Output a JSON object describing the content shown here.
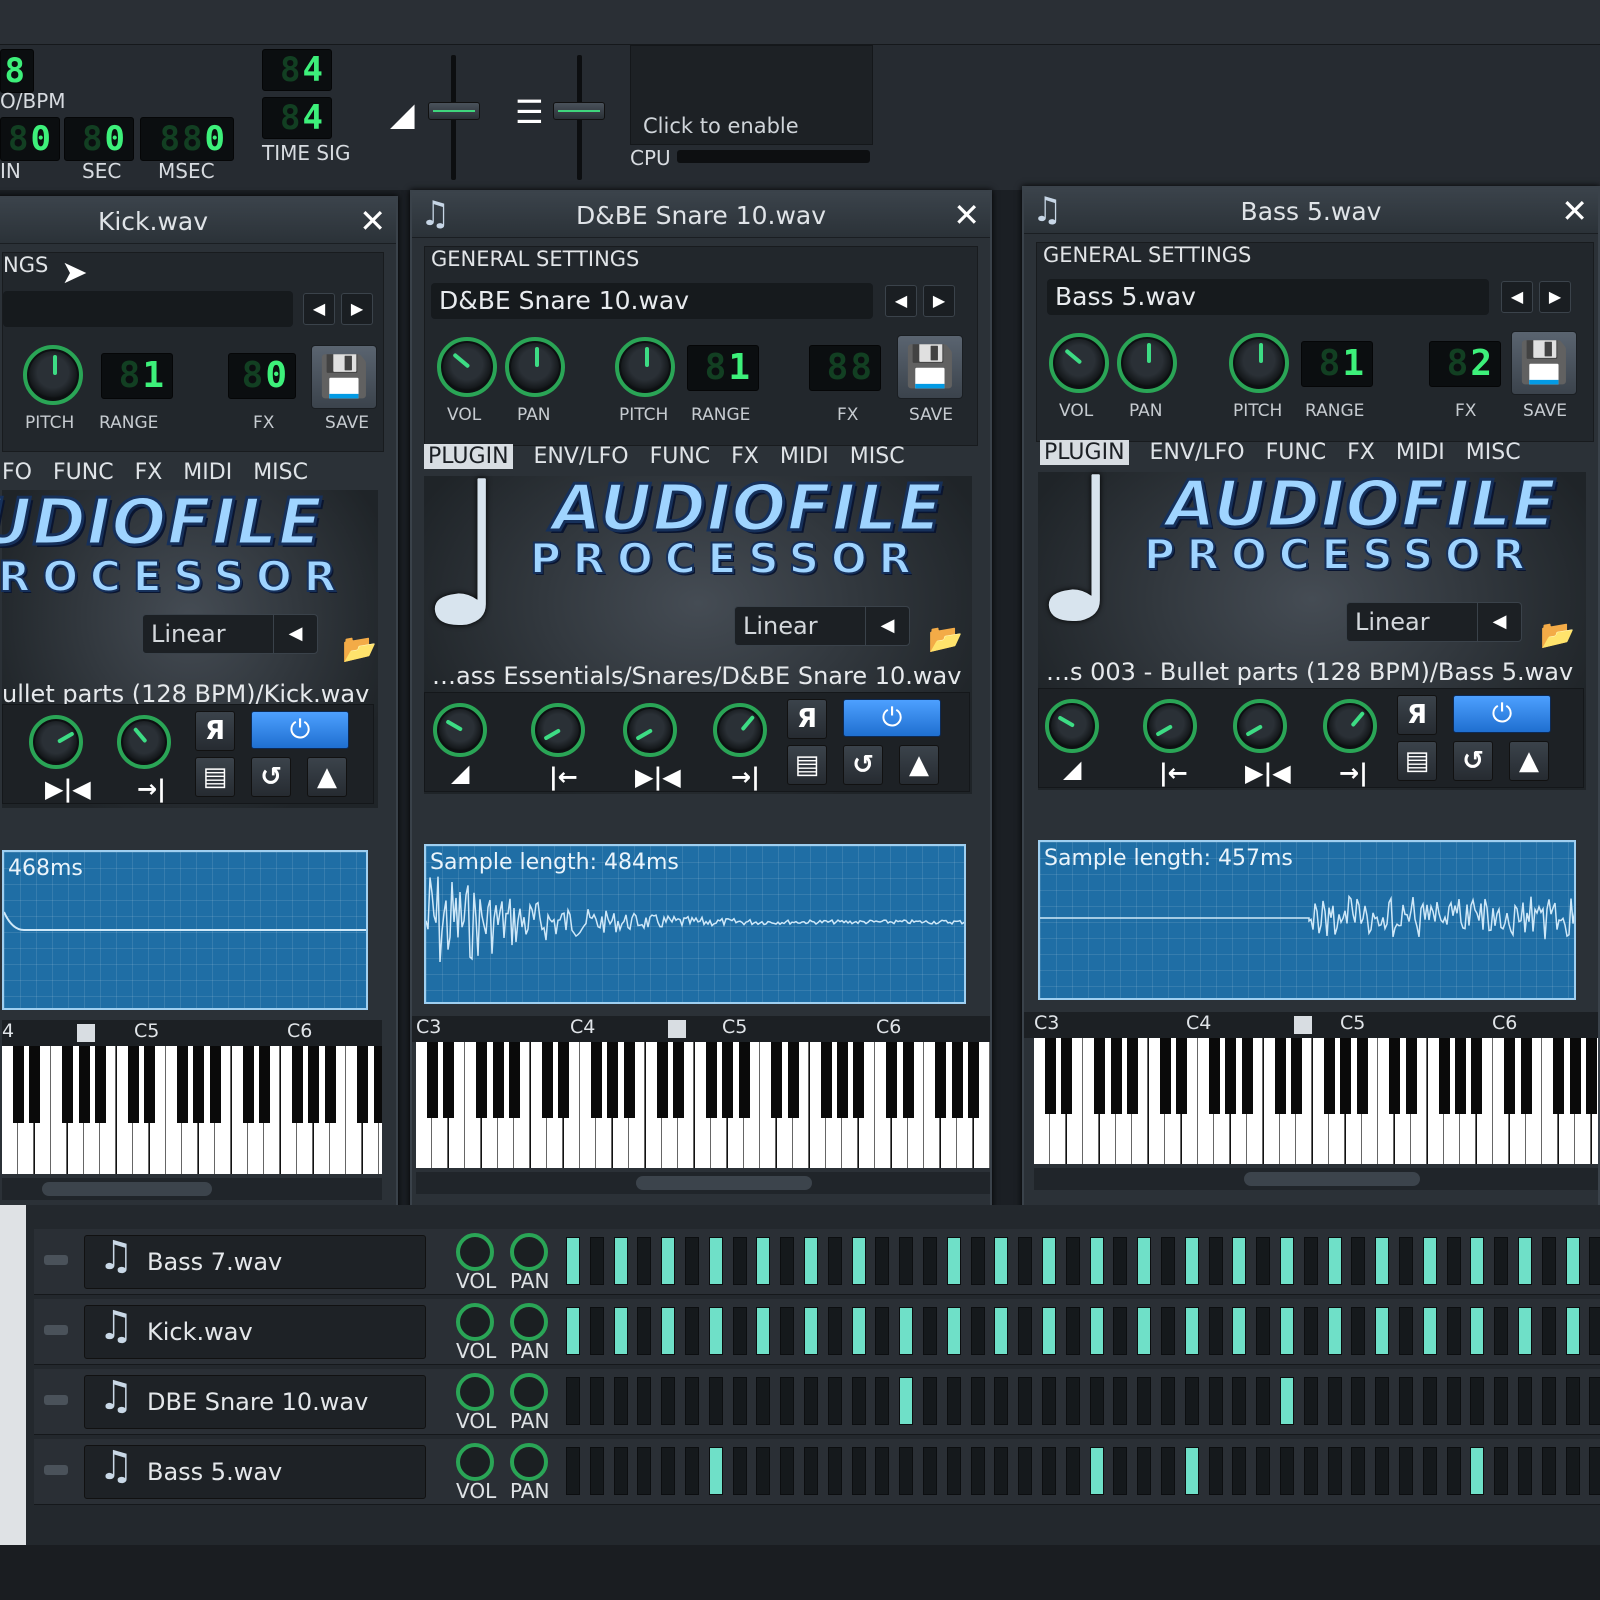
{
  "toolbar": {
    "tempo_value": "8",
    "tempo_label": "O/BPM",
    "min_value": "0",
    "min_ghost": "8",
    "sec_value": "0",
    "sec_ghost": "8",
    "msec_value": "0",
    "msec_ghost": "88",
    "min_label": "IN",
    "sec_label": "SEC",
    "msec_label": "MSEC",
    "timesig_num": "4",
    "timesig_den": "4",
    "timesig_ghost": "8",
    "timesig_label": "TIME SIG",
    "cpu_enable": "Click to enable",
    "cpu_label": "CPU"
  },
  "windows": [
    {
      "title": "Kick.wav",
      "section_header": "NGS",
      "name_field": "",
      "pitch_label": "PITCH",
      "range_label": "RANGE",
      "fx_label": "FX",
      "save_label": "SAVE",
      "range_value": "1",
      "range_ghost": "8",
      "fx_value": "0",
      "fx_ghost": "8",
      "tabs": [
        "FO",
        "FUNC",
        "FX",
        "MIDI",
        "MISC"
      ],
      "logo_top": "AUDIOFILE",
      "logo_bottom": "ROCESSOR",
      "interp": "Linear",
      "path": "ullet parts (128 BPM)/Kick.wav",
      "wave_text": "468ms",
      "kb_labels": [
        "4",
        "C5",
        "C6"
      ]
    },
    {
      "title": "D&BE Snare 10.wav",
      "section_header": "GENERAL SETTINGS",
      "name_field": "D&BE Snare 10.wav",
      "vol_label": "VOL",
      "pan_label": "PAN",
      "pitch_label": "PITCH",
      "range_label": "RANGE",
      "fx_label": "FX",
      "save_label": "SAVE",
      "range_value": "1",
      "range_ghost": "8",
      "fx_value": "8",
      "fx_ghost": "8",
      "tabs": [
        "PLUGIN",
        "ENV/LFO",
        "FUNC",
        "FX",
        "MIDI",
        "MISC"
      ],
      "logo_top": "AUDIOFILE",
      "logo_bottom": "PROCESSOR",
      "interp": "Linear",
      "path": "…ass Essentials/Snares/D&BE Snare 10.wav",
      "wave_text": "Sample length: 484ms",
      "kb_labels": [
        "C3",
        "C4",
        "C5",
        "C6"
      ]
    },
    {
      "title": "Bass 5.wav",
      "section_header": "GENERAL SETTINGS",
      "name_field": "Bass 5.wav",
      "vol_label": "VOL",
      "pan_label": "PAN",
      "pitch_label": "PITCH",
      "range_label": "RANGE",
      "fx_label": "FX",
      "save_label": "SAVE",
      "range_value": "1",
      "range_ghost": "8",
      "fx_value": "2",
      "fx_ghost": "8",
      "tabs": [
        "PLUGIN",
        "ENV/LFO",
        "FUNC",
        "FX",
        "MIDI",
        "MISC"
      ],
      "logo_top": "AUDIOFILE",
      "logo_bottom": "PROCESSOR",
      "interp": "Linear",
      "path": "…s 003 - Bullet parts (128 BPM)/Bass 5.wav",
      "wave_text": "Sample length: 457ms",
      "kb_labels": [
        "C3",
        "C4",
        "C5",
        "C6"
      ]
    }
  ],
  "tracks": [
    {
      "name": "Bass 7.wav",
      "vol": "VOL",
      "pan": "PAN",
      "steps": [
        1,
        1,
        1,
        1,
        1,
        1,
        1,
        0,
        1,
        1,
        1,
        1,
        1,
        1,
        1,
        1,
        1,
        1,
        1,
        1,
        1,
        1
      ]
    },
    {
      "name": "Kick.wav",
      "vol": "VOL",
      "pan": "PAN",
      "steps": [
        1,
        1,
        1,
        1,
        1,
        1,
        1,
        1,
        1,
        1,
        1,
        1,
        1,
        1,
        1,
        1,
        1,
        1,
        1,
        1,
        1,
        1
      ]
    },
    {
      "name": "DBE Snare 10.wav",
      "vol": "VOL",
      "pan": "PAN",
      "steps": [
        0,
        0,
        0,
        0,
        0,
        0,
        0,
        1,
        0,
        0,
        0,
        0,
        0,
        0,
        0,
        1,
        0,
        0,
        0,
        0,
        0,
        0
      ]
    },
    {
      "name": "Bass 5.wav",
      "vol": "VOL",
      "pan": "PAN",
      "steps": [
        0,
        0,
        0,
        1,
        0,
        0,
        0,
        0,
        0,
        0,
        0,
        1,
        0,
        1,
        0,
        0,
        0,
        0,
        0,
        1,
        0,
        0
      ]
    }
  ],
  "colors": {
    "accent_green": "#3df07a",
    "step_on": "#6fe0c8",
    "waveform": "#1f6ea5",
    "active_blue": "#3c8cf0"
  }
}
